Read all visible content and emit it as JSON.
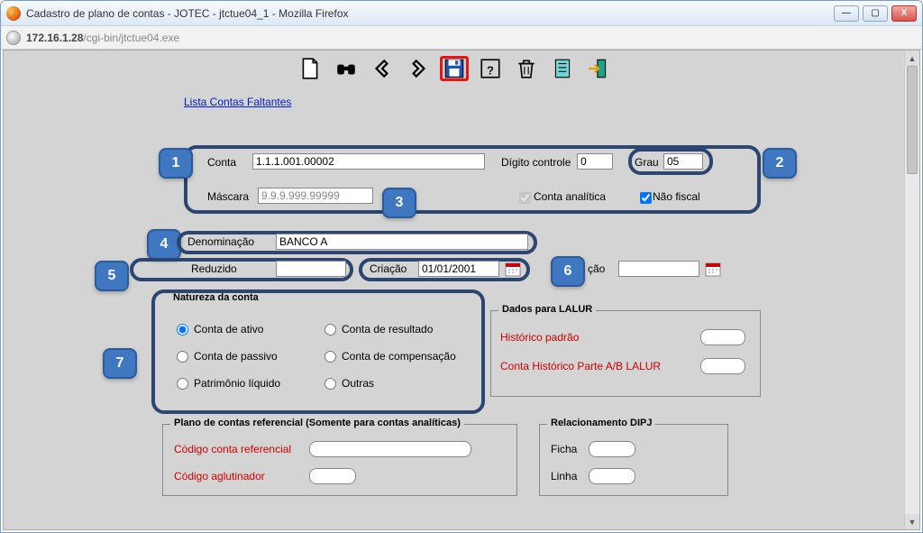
{
  "window": {
    "title": "Cadastro de plano de contas - JOTEC - jtctue04_1 - Mozilla Firefox",
    "url_host": "172.16.1.28",
    "url_path": "/cgi-bin/jtctue04.exe"
  },
  "toolbar_icons": {
    "new": "new-file-icon",
    "search": "binoculars-icon",
    "prev": "arrow-left-icon",
    "next": "arrow-right-icon",
    "save": "save-floppy-icon",
    "help": "question-icon",
    "delete": "trash-icon",
    "notes": "notepad-icon",
    "exit": "exit-door-icon"
  },
  "link_lista_contas": "Lista Contas Faltantes",
  "labels": {
    "conta": "Conta",
    "digito_controle": "Dígito controle",
    "grau": "Grau",
    "mascara": "Máscara",
    "conta_analitica": "Conta analítica",
    "nao_fiscal": "Não fiscal",
    "denominacao": "Denominação",
    "reduzido": "Reduzido",
    "criacao": "Criação",
    "alteracao_trunc": "ção"
  },
  "values": {
    "conta": "1.1.1.001.00002",
    "digito_controle": "0",
    "grau": "05",
    "mascara": "9.9.9.999.99999",
    "denominacao": "BANCO A",
    "reduzido": "",
    "criacao": "01/01/2001",
    "alteracao": ""
  },
  "checkboxes": {
    "conta_analitica": true,
    "nao_fiscal": true
  },
  "natureza": {
    "legend": "Natureza da conta",
    "options": {
      "ativo": "Conta de ativo",
      "passivo": "Conta de passivo",
      "patrimonio": "Patrimônio líquido",
      "resultado": "Conta de resultado",
      "compensacao": "Conta de compensação",
      "outras": "Outras"
    },
    "selected": "ativo"
  },
  "lalur": {
    "legend": "Dados para LALUR",
    "historico_padrao_label": "Histórico padrão",
    "conta_hist_label": "Conta Histórico Parte A/B LALUR",
    "historico_padrao": "",
    "conta_hist": ""
  },
  "plano_ref": {
    "legend": "Plano de contas referencial (Somente para contas analíticas)",
    "codigo_ref_label": "Código conta referencial",
    "codigo_aglut_label": "Código aglutinador",
    "codigo_ref": "",
    "codigo_aglut": ""
  },
  "dipj": {
    "legend": "Relacionamento DIPJ",
    "ficha_label": "Ficha",
    "linha_label": "Linha",
    "ficha": "",
    "linha": ""
  },
  "callouts": {
    "c1": "1",
    "c2": "2",
    "c3": "3",
    "c4": "4",
    "c5": "5",
    "c6": "6",
    "c7": "7"
  }
}
